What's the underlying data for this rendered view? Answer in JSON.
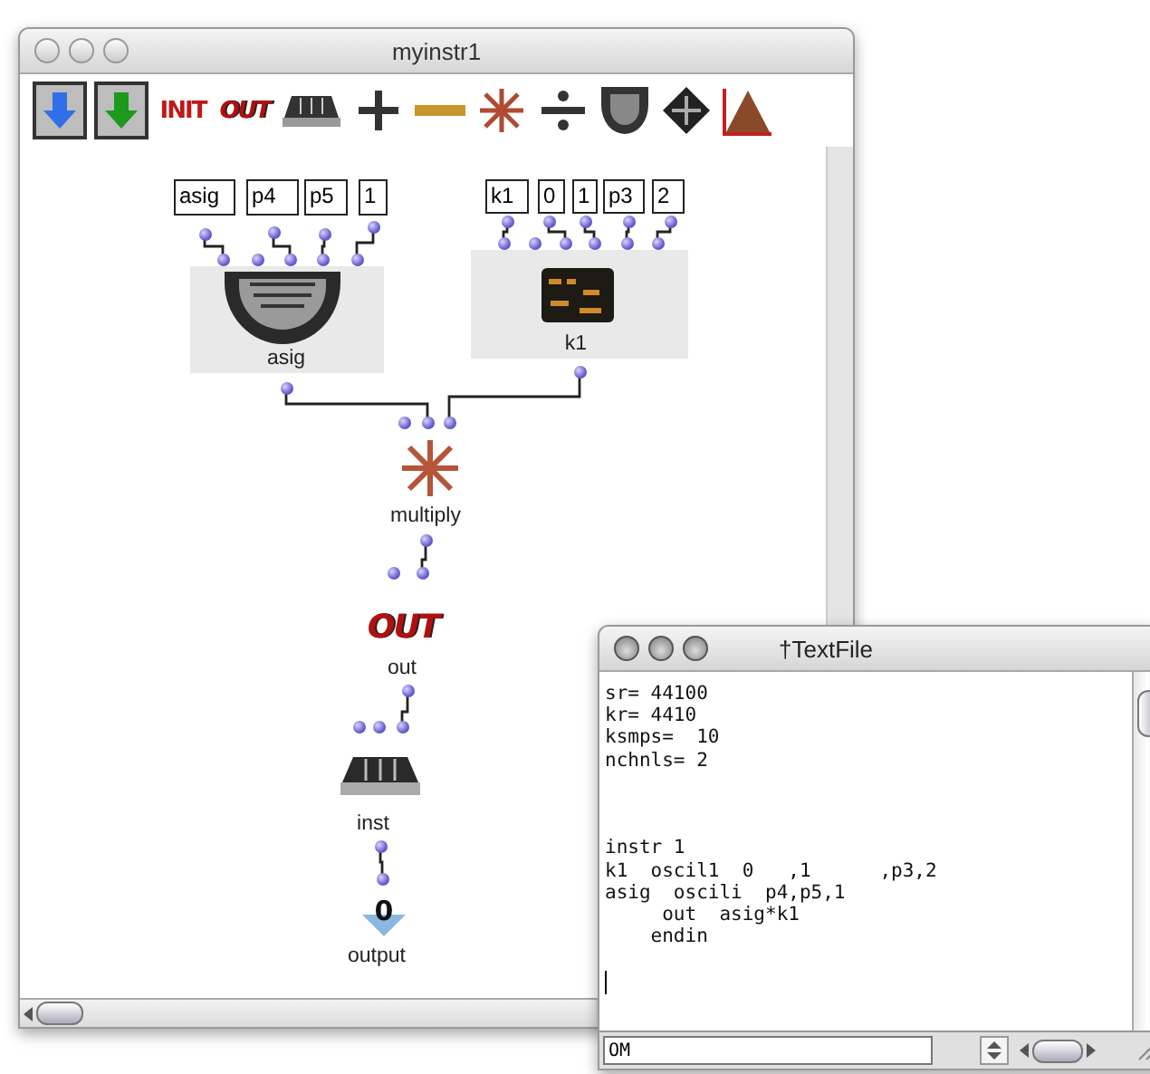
{
  "window": {
    "title": "myinstr1"
  },
  "toolbar": [
    {
      "kind": "input-arrow"
    },
    {
      "kind": "output-arrow"
    },
    {
      "kind": "init",
      "text": "INIT"
    },
    {
      "kind": "out",
      "text": "OUT"
    },
    {
      "kind": "instrument"
    },
    {
      "kind": "plus"
    },
    {
      "kind": "dash"
    },
    {
      "kind": "multiply"
    },
    {
      "kind": "divide"
    },
    {
      "kind": "dome"
    },
    {
      "kind": "diamond"
    },
    {
      "kind": "mountain"
    }
  ],
  "nodes": [
    {
      "kind": "oscili",
      "label": "asig",
      "args": [
        "asig",
        "p4",
        "p5",
        "1"
      ]
    },
    {
      "kind": "oscil1",
      "label": "k1",
      "args": [
        "k1",
        "0",
        "1",
        "p3",
        "2"
      ]
    },
    {
      "kind": "multiply",
      "label": "multiply"
    },
    {
      "kind": "out",
      "label": "out",
      "icon_text": "OUT"
    },
    {
      "kind": "instrument",
      "label": "inst"
    },
    {
      "kind": "output",
      "label": "output",
      "icon_text": "0"
    }
  ],
  "text_window": {
    "title": "†TextFile",
    "code": "sr= 44100\nkr= 4410\nksmps=  10\nnchnls= 2\n\n\n\ninstr 1\nk1  oscil1  0   ,1      ,p3,2\nasig  oscili  p4,p5,1\n     out  asig*k1\n    endin",
    "input": "OM"
  }
}
